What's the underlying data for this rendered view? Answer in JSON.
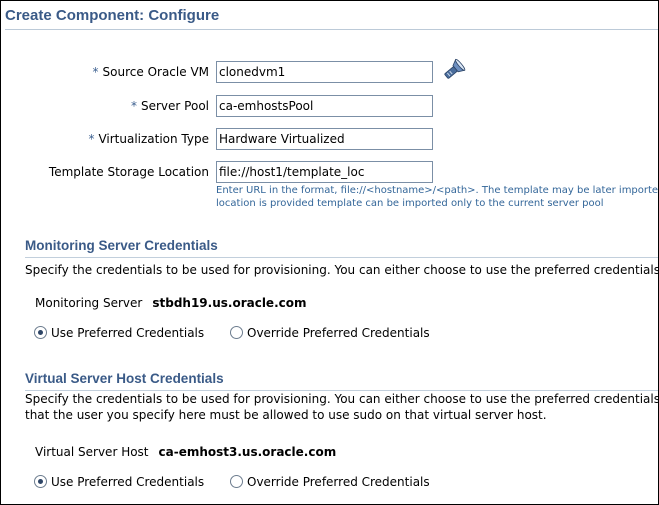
{
  "page": {
    "title": "Create Component: Configure"
  },
  "form": {
    "required_marker": "*",
    "source_vm": {
      "label": "Source Oracle VM",
      "value": "clonedvm1"
    },
    "server_pool": {
      "label": "Server Pool",
      "value": "ca-emhostsPool"
    },
    "virtualization_type": {
      "label": "Virtualization Type",
      "value": "Hardware Virtualized"
    },
    "template_location": {
      "label": "Template Storage Location",
      "value": "file://host1/template_loc",
      "hint_line1": "Enter URL in the format, file://<hostname>/<path>. The template may be later imported to only",
      "hint_line2": "location is provided template can be imported only to the current server pool"
    },
    "icons": {
      "search": "flashlight-search-icon"
    }
  },
  "monitoring": {
    "title": "Monitoring Server Credentials",
    "description": "Specify the credentials to be used for provisioning. You can either choose to use the preferred credentials set",
    "server_label": "Monitoring Server",
    "server_value": "stbdh19.us.oracle.com",
    "radio_preferred": "Use Preferred Credentials",
    "radio_override": "Override Preferred Credentials",
    "selected": "preferred"
  },
  "virtual_host": {
    "title": "Virtual Server Host Credentials",
    "description_line1": "Specify the credentials to be used for provisioning. You can either choose to use the preferred credentials set",
    "description_line2": "that the user you specify here must be allowed to use sudo on that virtual server host.",
    "host_label": "Virtual Server Host",
    "host_value": "ca-emhost3.us.oracle.com",
    "radio_preferred": "Use Preferred Credentials",
    "radio_override": "Override Preferred Credentials",
    "selected": "preferred"
  },
  "colors": {
    "title": "#3a5a87",
    "hint": "#336699",
    "border": "#7b8fa6"
  }
}
